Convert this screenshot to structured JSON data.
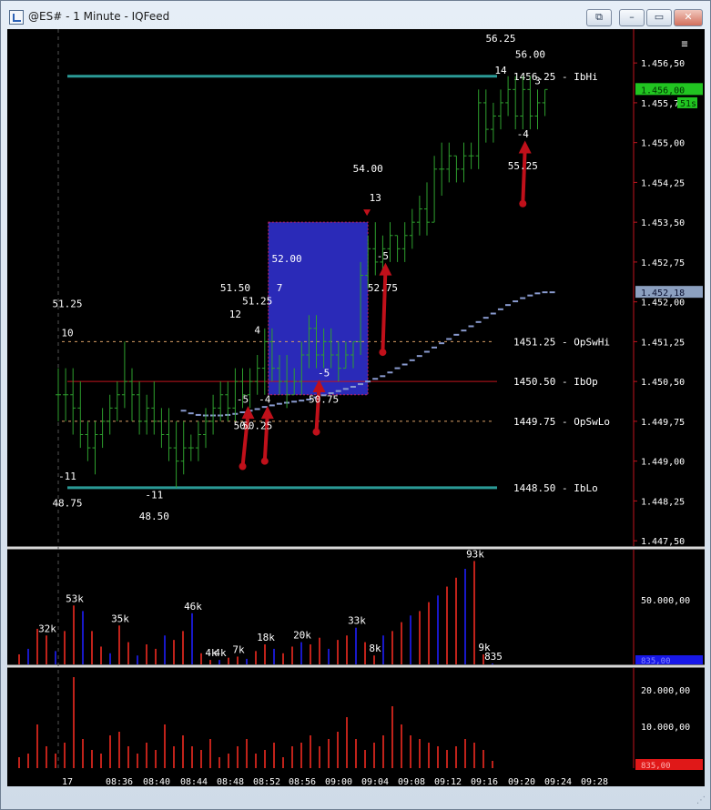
{
  "window": {
    "title": "@ES# - 1 Minute - IQFeed",
    "icon": "chart-app-icon"
  },
  "window_controls": {
    "restore": "⧉",
    "minimize": "–",
    "maximize": "▭",
    "close": "✕"
  },
  "colors": {
    "background": "#000000",
    "up": "#2e9f2e",
    "down": "#2e9f2e",
    "ib_line": "#2a9a96",
    "ibop_line": "#c0151e",
    "sw_line": "#d9a066",
    "vwap": "#8a9bd0",
    "box": "#2a2ab8",
    "arrow": "#c0101a",
    "vol_buy": "#1818c8",
    "vol_sell": "#c0221a",
    "axis": "#c0151e",
    "text": "#ffffff"
  },
  "chart_data": [
    {
      "type": "ohlc",
      "ylim": [
        1447.4,
        1457.0
      ],
      "price_axis_ticks": [
        "1.456,50",
        "1.455,75",
        "1.455,00",
        "1.454,25",
        "1.453,50",
        "1.452,75",
        "1.452,00",
        "1.451,25",
        "1.450,50",
        "1.449,75",
        "1.449,00",
        "1.448,25",
        "1.447,50"
      ],
      "last_price_label": "1.456,00",
      "timer_label": "51s",
      "vwap_label": "1.452,18",
      "levels": [
        {
          "name": "IbHi",
          "price": 1456.25,
          "label": "1456.25 - IbHi",
          "style": "solid"
        },
        {
          "name": "OpSwHi",
          "price": 1451.25,
          "label": "1451.25 - OpSwHi",
          "style": "dashed"
        },
        {
          "name": "IbOp",
          "price": 1450.5,
          "label": "1450.50 - IbOp",
          "style": "solid"
        },
        {
          "name": "OpSwLo",
          "price": 1449.75,
          "label": "1449.75 - OpSwLo",
          "style": "dashed"
        },
        {
          "name": "IbLo",
          "price": 1448.5,
          "label": "1448.50 - IbLo",
          "style": "solid"
        }
      ],
      "bars": [
        [
          1450.25,
          1450.75,
          1449.75,
          1450.25
        ],
        [
          1450.25,
          1450.75,
          1449.75,
          1450.25
        ],
        [
          1450.25,
          1450.75,
          1449.5,
          1450.0
        ],
        [
          1450.0,
          1450.5,
          1449.25,
          1449.5
        ],
        [
          1449.5,
          1449.75,
          1449.0,
          1449.25
        ],
        [
          1449.25,
          1449.75,
          1448.75,
          1449.5
        ],
        [
          1449.5,
          1450.0,
          1449.25,
          1449.75
        ],
        [
          1449.75,
          1450.25,
          1449.5,
          1450.0
        ],
        [
          1450.0,
          1450.5,
          1449.75,
          1450.25
        ],
        [
          1450.25,
          1451.25,
          1450.0,
          1450.5
        ],
        [
          1450.5,
          1450.75,
          1449.75,
          1450.25
        ],
        [
          1450.25,
          1450.5,
          1449.5,
          1449.75
        ],
        [
          1449.75,
          1450.25,
          1449.5,
          1450.0
        ],
        [
          1450.0,
          1450.5,
          1449.5,
          1449.75
        ],
        [
          1449.75,
          1450.0,
          1449.25,
          1449.5
        ],
        [
          1449.5,
          1450.0,
          1449.0,
          1449.25
        ],
        [
          1449.25,
          1449.75,
          1448.5,
          1449.0
        ],
        [
          1449.0,
          1449.75,
          1448.75,
          1449.25
        ],
        [
          1449.25,
          1449.5,
          1449.0,
          1449.25
        ],
        [
          1449.25,
          1449.75,
          1449.0,
          1449.5
        ],
        [
          1449.5,
          1450.0,
          1449.25,
          1449.75
        ],
        [
          1449.75,
          1450.25,
          1449.5,
          1450.0
        ],
        [
          1450.0,
          1450.5,
          1449.75,
          1450.25
        ],
        [
          1450.25,
          1450.5,
          1449.75,
          1450.0
        ],
        [
          1450.0,
          1450.75,
          1449.75,
          1450.5
        ],
        [
          1450.5,
          1450.75,
          1450.0,
          1450.25
        ],
        [
          1450.25,
          1450.75,
          1450.0,
          1450.5
        ],
        [
          1450.5,
          1451.0,
          1450.25,
          1450.75
        ],
        [
          1450.75,
          1451.5,
          1450.25,
          1451.25
        ],
        [
          1451.25,
          1451.5,
          1450.5,
          1450.75
        ],
        [
          1450.75,
          1451.0,
          1450.25,
          1450.5
        ],
        [
          1450.5,
          1451.0,
          1450.0,
          1450.25
        ],
        [
          1450.25,
          1450.75,
          1450.25,
          1450.5
        ],
        [
          1450.5,
          1451.25,
          1450.25,
          1451.0
        ],
        [
          1451.0,
          1451.75,
          1450.75,
          1451.5
        ],
        [
          1451.5,
          1451.75,
          1450.75,
          1451.0
        ],
        [
          1451.0,
          1451.5,
          1450.75,
          1451.25
        ],
        [
          1451.25,
          1451.5,
          1450.75,
          1451.0
        ],
        [
          1451.0,
          1451.25,
          1450.5,
          1450.75
        ],
        [
          1450.75,
          1451.25,
          1450.75,
          1451.0
        ],
        [
          1451.0,
          1451.25,
          1450.75,
          1451.25
        ],
        [
          1451.25,
          1452.75,
          1451.0,
          1452.5
        ],
        [
          1452.5,
          1453.25,
          1452.25,
          1453.0
        ],
        [
          1453.0,
          1453.5,
          1452.5,
          1452.75
        ],
        [
          1452.75,
          1453.25,
          1452.5,
          1453.0
        ],
        [
          1453.0,
          1453.5,
          1452.75,
          1453.25
        ],
        [
          1453.25,
          1453.25,
          1452.75,
          1453.0
        ],
        [
          1453.0,
          1453.5,
          1452.75,
          1453.25
        ],
        [
          1453.25,
          1453.75,
          1453.0,
          1453.5
        ],
        [
          1453.5,
          1454.0,
          1453.25,
          1453.75
        ],
        [
          1453.75,
          1454.25,
          1453.25,
          1453.5
        ],
        [
          1453.5,
          1454.75,
          1453.5,
          1454.5
        ],
        [
          1454.5,
          1455.0,
          1454.0,
          1454.5
        ],
        [
          1454.5,
          1455.0,
          1454.25,
          1454.75
        ],
        [
          1454.75,
          1454.75,
          1454.25,
          1454.5
        ],
        [
          1454.5,
          1455.0,
          1454.25,
          1454.75
        ],
        [
          1454.75,
          1455.0,
          1454.5,
          1454.75
        ],
        [
          1454.75,
          1456.0,
          1454.5,
          1455.75
        ],
        [
          1455.75,
          1456.0,
          1455.0,
          1455.25
        ],
        [
          1455.25,
          1455.75,
          1455.0,
          1455.5
        ],
        [
          1455.5,
          1456.0,
          1455.25,
          1455.75
        ],
        [
          1455.75,
          1456.25,
          1455.5,
          1456.0
        ],
        [
          1456.0,
          1456.25,
          1455.25,
          1455.5
        ],
        [
          1455.5,
          1456.25,
          1455.25,
          1456.0
        ],
        [
          1456.0,
          1456.25,
          1455.25,
          1455.5
        ],
        [
          1455.5,
          1456.0,
          1455.25,
          1455.75
        ],
        [
          1455.75,
          1456.0,
          1455.5,
          1456.0
        ]
      ],
      "vwap": [
        1449.95,
        1449.9,
        1449.87,
        1449.86,
        1449.86,
        1449.86,
        1449.87,
        1449.89,
        1449.92,
        1449.95,
        1449.98,
        1450.02,
        1450.05,
        1450.08,
        1450.1,
        1450.12,
        1450.14,
        1450.16,
        1450.2,
        1450.24,
        1450.28,
        1450.32,
        1450.36,
        1450.4,
        1450.45,
        1450.5,
        1450.55,
        1450.6,
        1450.67,
        1450.75,
        1450.82,
        1450.9,
        1450.98,
        1451.06,
        1451.14,
        1451.22,
        1451.3,
        1451.38,
        1451.46,
        1451.54,
        1451.62,
        1451.7,
        1451.78,
        1451.86,
        1451.94,
        1452.01,
        1452.07,
        1452.12,
        1452.16,
        1452.18,
        1452.18
      ],
      "vwap_start_index": 16,
      "box": {
        "from_index": 28,
        "to_index": 41,
        "high": 1453.5,
        "low": 1450.25
      },
      "annotations": [
        {
          "text": "51.25",
          "price": 1451.9,
          "index": -1
        },
        {
          "text": "10",
          "price": 1451.35,
          "index": -1
        },
        {
          "text": "-11",
          "price": 1448.65,
          "index": -1
        },
        {
          "text": "48.75",
          "price": 1448.15,
          "index": -1
        },
        {
          "text": "-11",
          "price": 1448.3,
          "index": 13
        },
        {
          "text": "48.50",
          "price": 1447.9,
          "index": 13
        },
        {
          "text": "51.50",
          "price": 1452.2,
          "index": 24
        },
        {
          "text": "51.25",
          "price": 1451.95,
          "index": 27
        },
        {
          "text": "12",
          "price": 1451.7,
          "index": 24
        },
        {
          "text": "4",
          "price": 1451.4,
          "index": 27
        },
        {
          "text": "7",
          "price": 1452.2,
          "index": 30
        },
        {
          "text": "52.00",
          "price": 1452.75,
          "index": 31
        },
        {
          "text": "-5",
          "price": 1450.1,
          "index": 25
        },
        {
          "text": "-4",
          "price": 1450.1,
          "index": 28
        },
        {
          "text": "50.25",
          "price": 1449.6,
          "index": 27
        },
        {
          "text": "50.",
          "price": 1449.6,
          "index": 25
        },
        {
          "text": "-5",
          "price": 1450.6,
          "index": 36
        },
        {
          "text": "50.75",
          "price": 1450.1,
          "index": 36
        },
        {
          "text": "54.00",
          "price": 1454.45,
          "index": 42
        },
        {
          "text": "13",
          "price": 1453.9,
          "index": 43
        },
        {
          "text": "-5",
          "price": 1452.8,
          "index": 44
        },
        {
          "text": "52.75",
          "price": 1452.2,
          "index": 44
        },
        {
          "text": "56.25",
          "price": 1456.9,
          "index": 60
        },
        {
          "text": "56.00",
          "price": 1456.6,
          "index": 64
        },
        {
          "text": "14",
          "price": 1456.3,
          "index": 60
        },
        {
          "text": "3",
          "price": 1456.1,
          "index": 65
        },
        {
          "text": "-4",
          "price": 1455.1,
          "index": 63
        },
        {
          "text": "55.25",
          "price": 1454.5,
          "index": 63
        }
      ],
      "arrows": [
        {
          "from_index": 25,
          "from_price": 1448.9,
          "to_price": 1449.9,
          "dx": 1
        },
        {
          "from_index": 28,
          "from_price": 1449.0,
          "to_price": 1449.9,
          "dx": 0.5
        },
        {
          "from_index": 35,
          "from_price": 1449.55,
          "to_price": 1450.4,
          "dx": 0.5
        },
        {
          "from_index": 44,
          "from_price": 1451.05,
          "to_price": 1452.6,
          "dx": 0.5
        },
        {
          "from_index": 63,
          "from_price": 1453.85,
          "to_price": 1454.9,
          "dx": 0.4
        }
      ]
    },
    {
      "type": "bar",
      "name": "volume",
      "ylim": [
        0,
        95000
      ],
      "ticks": [
        "50.000,00"
      ],
      "last_label": "835,00",
      "values": [
        9000,
        14000,
        32000,
        26000,
        12000,
        30000,
        53000,
        48000,
        30000,
        16000,
        10000,
        35000,
        20000,
        8000,
        18000,
        14000,
        26000,
        22000,
        30000,
        46000,
        10000,
        4000,
        4000,
        6000,
        7000,
        5000,
        12000,
        18000,
        14000,
        10000,
        16000,
        20000,
        18000,
        24000,
        14000,
        22000,
        26000,
        33000,
        20000,
        8000,
        26000,
        30000,
        38000,
        44000,
        48000,
        56000,
        62000,
        70000,
        78000,
        86000,
        93000,
        9000,
        835
      ],
      "labels": [
        {
          "text": "32k",
          "index": 3
        },
        {
          "text": "53k",
          "index": 6
        },
        {
          "text": "35k",
          "index": 11
        },
        {
          "text": "46k",
          "index": 19
        },
        {
          "text": "4k",
          "index": 21
        },
        {
          "text": "4k",
          "index": 22
        },
        {
          "text": "7k",
          "index": 24
        },
        {
          "text": "18k",
          "index": 27
        },
        {
          "text": "20k",
          "index": 31
        },
        {
          "text": "33k",
          "index": 37
        },
        {
          "text": "8k",
          "index": 39
        },
        {
          "text": "93k",
          "index": 50
        },
        {
          "text": "9k",
          "index": 51
        },
        {
          "text": "835",
          "index": 52
        }
      ]
    },
    {
      "type": "bar",
      "name": "delta-volume",
      "ylim": [
        0,
        26000
      ],
      "ticks": [
        "20.000,00",
        "10.000,00"
      ],
      "last_label": "835,00",
      "values": [
        3000,
        4000,
        12000,
        6000,
        4000,
        7000,
        25000,
        8000,
        5000,
        4000,
        9000,
        10000,
        6000,
        4000,
        7000,
        5000,
        12000,
        6000,
        9000,
        6000,
        5000,
        8000,
        3000,
        4000,
        6000,
        8000,
        4000,
        5000,
        7000,
        3000,
        6000,
        7000,
        9000,
        6000,
        8000,
        10000,
        14000,
        8000,
        5000,
        7000,
        9000,
        17000,
        12000,
        9000,
        8000,
        7000,
        6000,
        5000,
        6000,
        8000,
        7000,
        5000,
        2000
      ],
      "time_labels": [
        "17",
        "08:36",
        "08:40",
        "08:44",
        "08:48",
        "08:52",
        "08:56",
        "09:00",
        "09:04",
        "09:08",
        "09:12",
        "09:16",
        "09:20",
        "09:24",
        "09:28"
      ]
    }
  ]
}
